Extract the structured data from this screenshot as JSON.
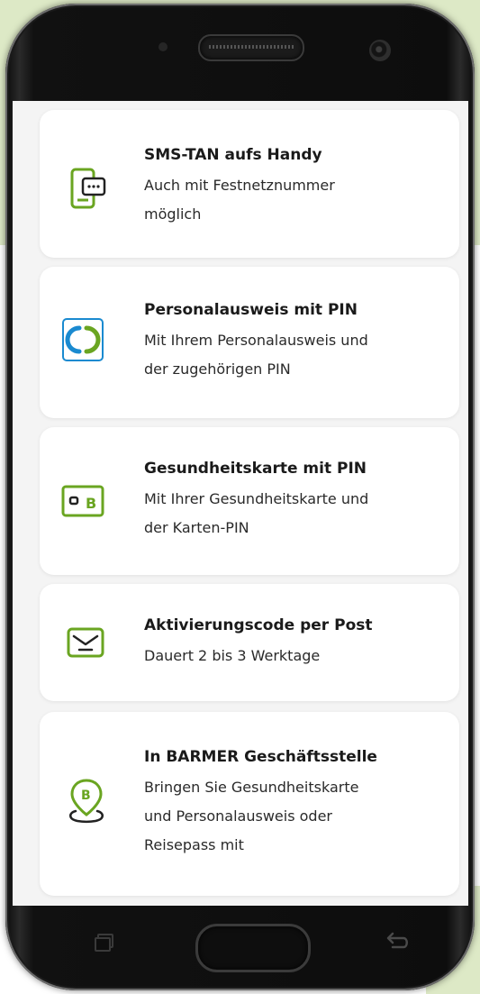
{
  "options": [
    {
      "title": "SMS-TAN aufs Handy",
      "description_lines": [
        "Auch mit Festnetznummer",
        "möglich"
      ],
      "icon": "phone-sms-icon"
    },
    {
      "title": "Personalausweis mit PIN",
      "description_lines": [
        "Mit Ihrem Personalausweis und",
        "der zugehörigen PIN"
      ],
      "icon": "id-card-icon"
    },
    {
      "title": "Gesundheitskarte mit PIN",
      "description_lines": [
        "Mit Ihrer Gesundheitskarte und",
        "der Karten-PIN"
      ],
      "icon": "health-card-icon",
      "icon_letter": "B"
    },
    {
      "title": "Aktivierungscode per Post",
      "description_lines": [
        "Dauert 2 bis 3 Werktage"
      ],
      "icon": "envelope-icon"
    },
    {
      "title": "In BARMER Geschäftsstelle",
      "description_lines": [
        "Bringen Sie Gesundheitskarte",
        "und Personalausweis oder",
        "Reisepass mit"
      ],
      "icon": "location-pin-icon",
      "icon_letter": "B"
    }
  ],
  "colors": {
    "accent_green": "#6aa521",
    "id_blue": "#1a8ad0",
    "background_green": "#dde9c6",
    "card_bg": "#ffffff",
    "screen_bg": "#f4f4f4"
  },
  "device": {
    "buttons": [
      "recent-apps-button",
      "home-button",
      "back-button"
    ]
  }
}
